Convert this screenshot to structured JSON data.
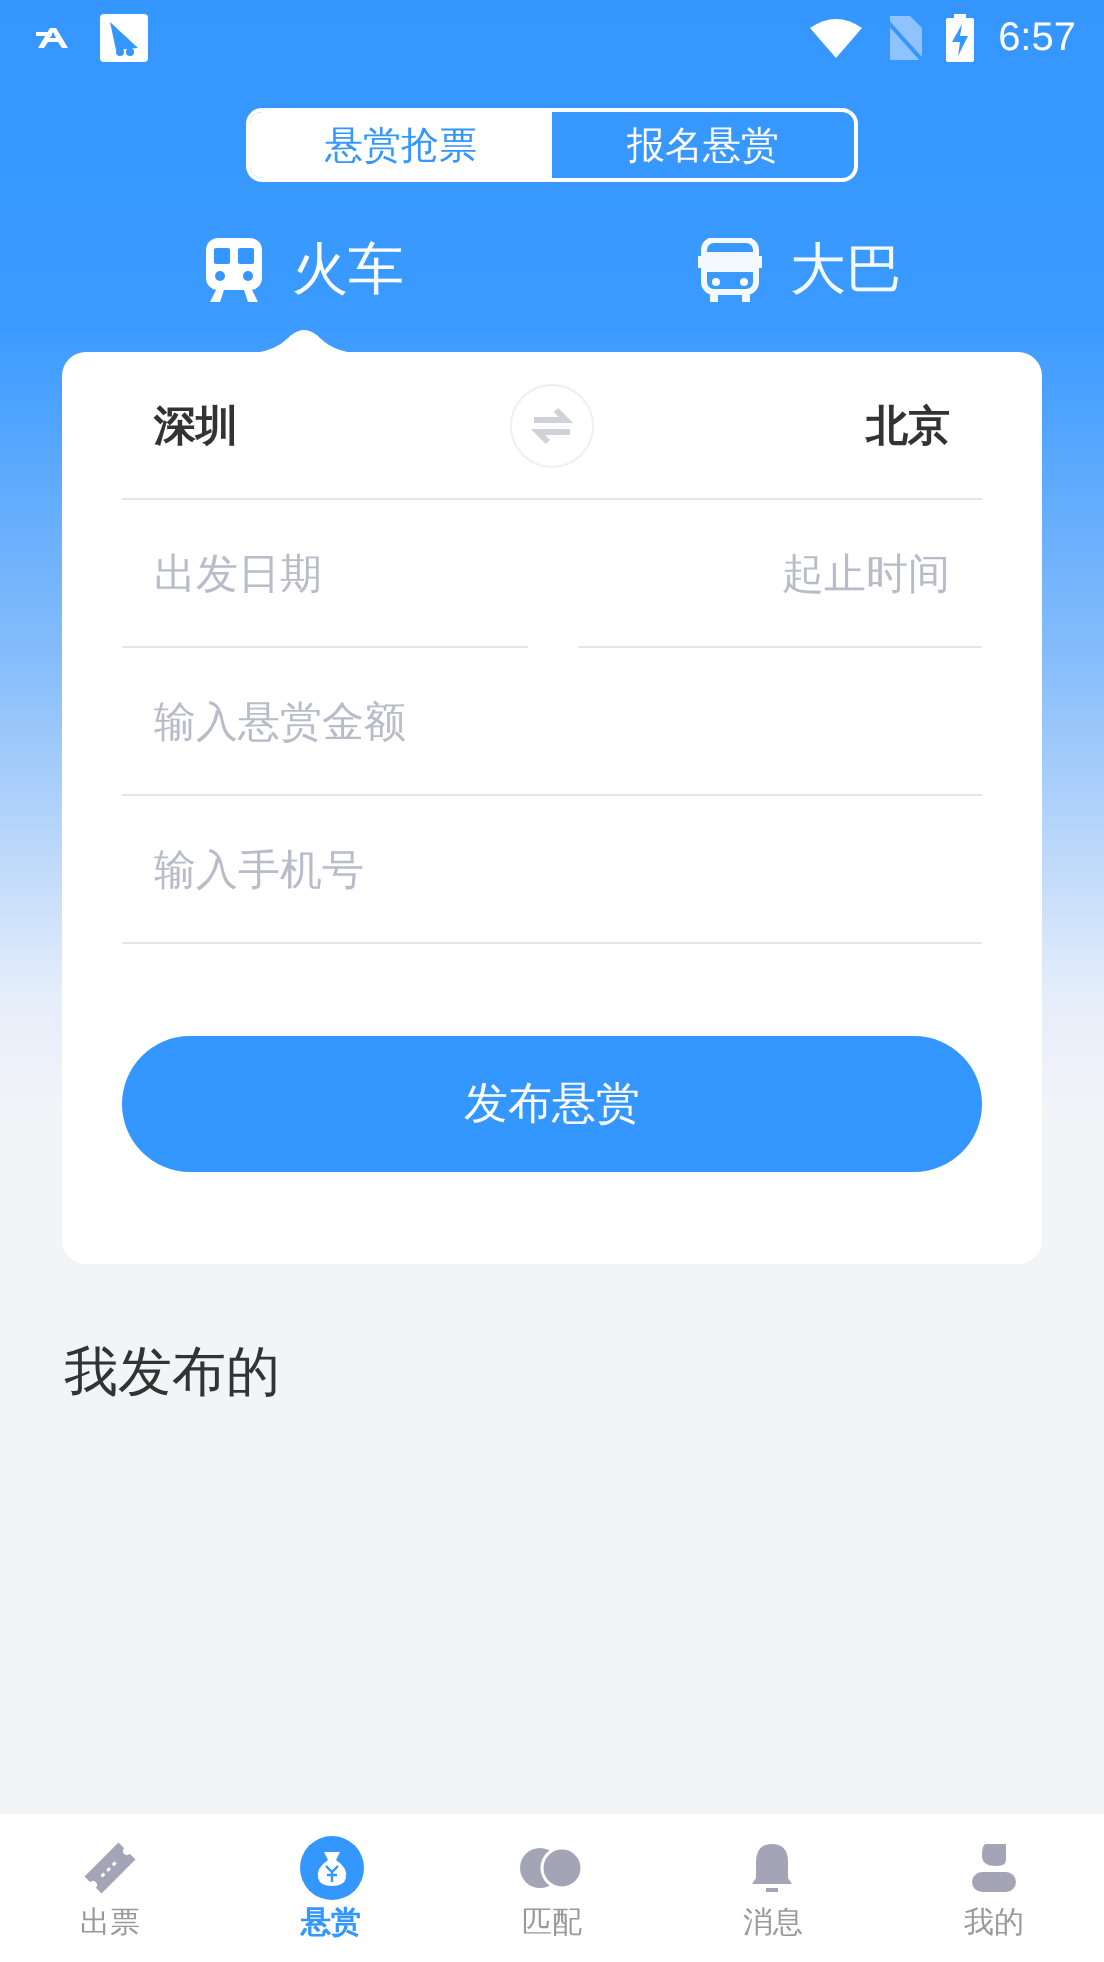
{
  "status_bar": {
    "time": "6:57"
  },
  "mode_tabs": [
    {
      "label": "悬赏抢票",
      "selected": true
    },
    {
      "label": "报名悬赏",
      "selected": false
    }
  ],
  "transport_tabs": [
    {
      "label": "火车",
      "kind": "train",
      "selected": true
    },
    {
      "label": "大巴",
      "kind": "bus",
      "selected": false
    }
  ],
  "route": {
    "from": "深圳",
    "to": "北京"
  },
  "fields": {
    "date": {
      "placeholder": "出发日期"
    },
    "time": {
      "placeholder": "起止时间"
    },
    "amount": {
      "placeholder": "输入悬赏金额"
    },
    "phone": {
      "placeholder": "输入手机号"
    }
  },
  "submit_button": "发布悬赏",
  "section_title": "我发布的",
  "bottom_nav": [
    {
      "label": "出票",
      "kind": "ticket",
      "selected": false
    },
    {
      "label": "悬赏",
      "kind": "moneybag",
      "selected": true
    },
    {
      "label": "匹配",
      "kind": "match",
      "selected": false
    },
    {
      "label": "消息",
      "kind": "bell",
      "selected": false
    },
    {
      "label": "我的",
      "kind": "person",
      "selected": false
    }
  ]
}
